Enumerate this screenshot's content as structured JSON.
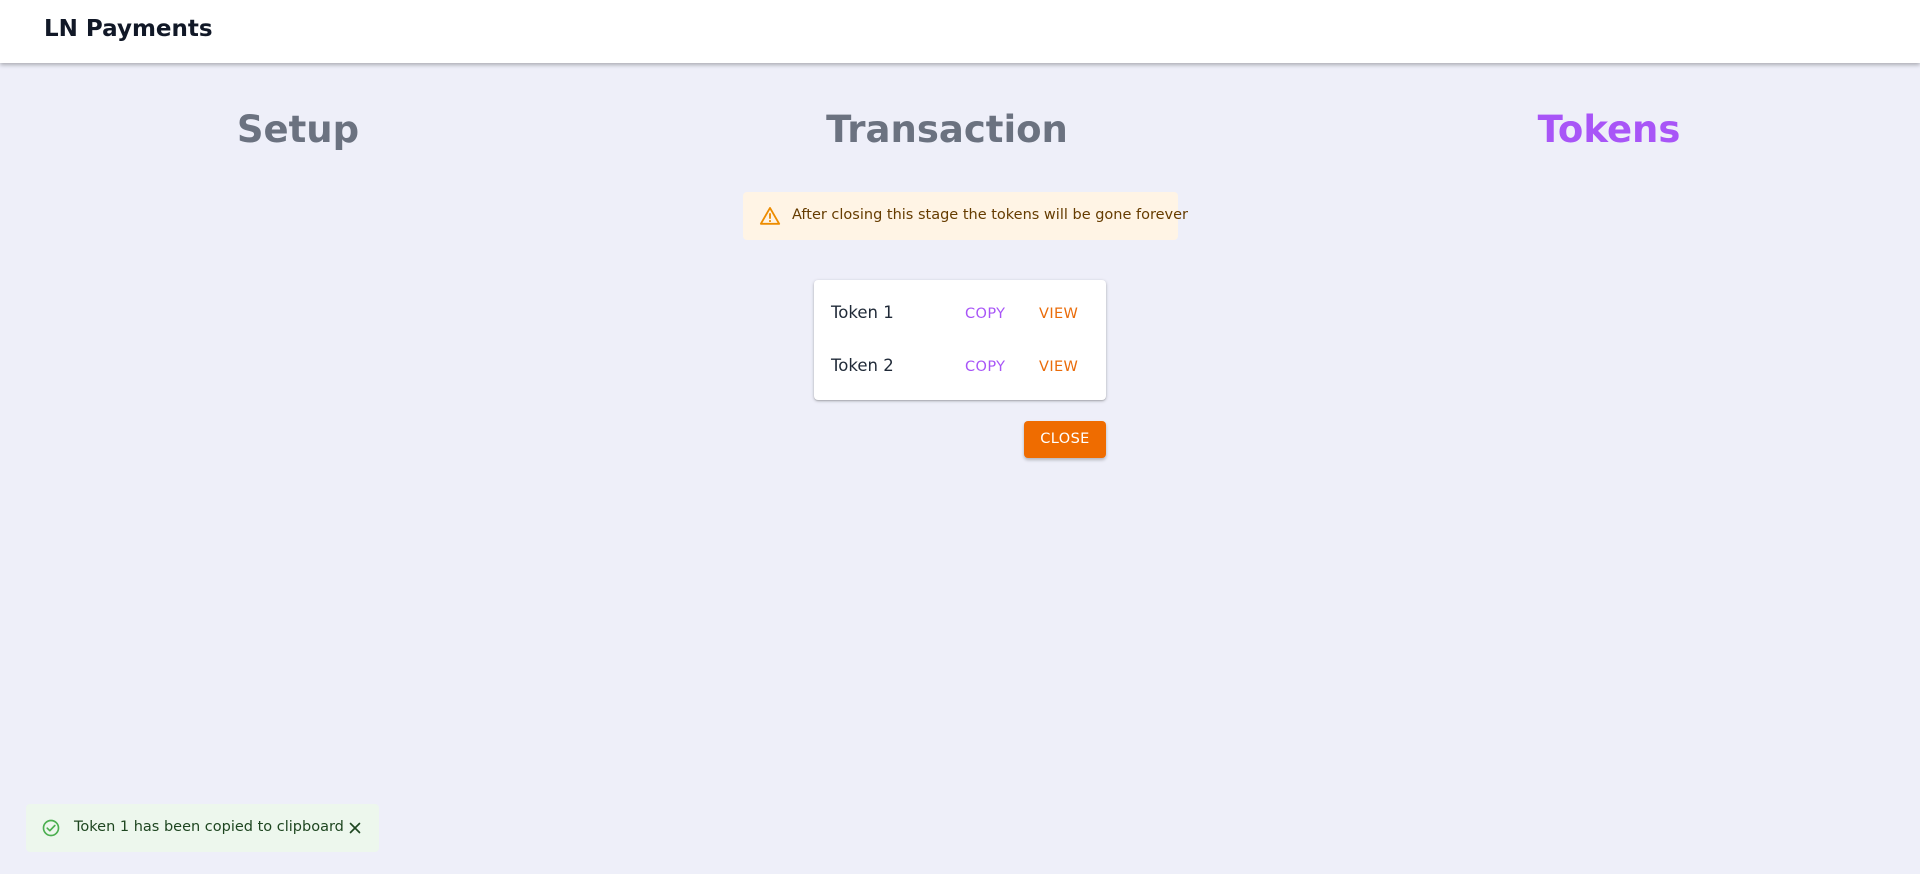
{
  "app": {
    "title": "LN Payments"
  },
  "steps": [
    {
      "label": "Setup",
      "active": false
    },
    {
      "label": "Transaction",
      "active": false
    },
    {
      "label": "Tokens",
      "active": true
    }
  ],
  "alert": {
    "severity": "warning",
    "icon": "warning-triangle-icon",
    "message": "After closing this stage the tokens will be gone forever"
  },
  "tokens": [
    {
      "name": "Token 1",
      "copy_label": "COPY",
      "view_label": "VIEW"
    },
    {
      "name": "Token 2",
      "copy_label": "COPY",
      "view_label": "VIEW"
    }
  ],
  "actions": {
    "close_label": "CLOSE"
  },
  "snackbar": {
    "severity": "success",
    "icon": "check-circle-icon",
    "message": "Token 1 has been copied to clipboard",
    "close_icon": "close-icon"
  },
  "colors": {
    "background": "#eeeff9",
    "step_inactive": "#6b7280",
    "step_active": "#a855f7",
    "copy": "#a855f7",
    "view": "#ea6c0a",
    "close_button": "#ef6c00",
    "warning_bg": "#fff4e5",
    "warning_icon": "#ed8c00",
    "success_bg": "#edf7ed",
    "success_icon": "#4caf50"
  }
}
